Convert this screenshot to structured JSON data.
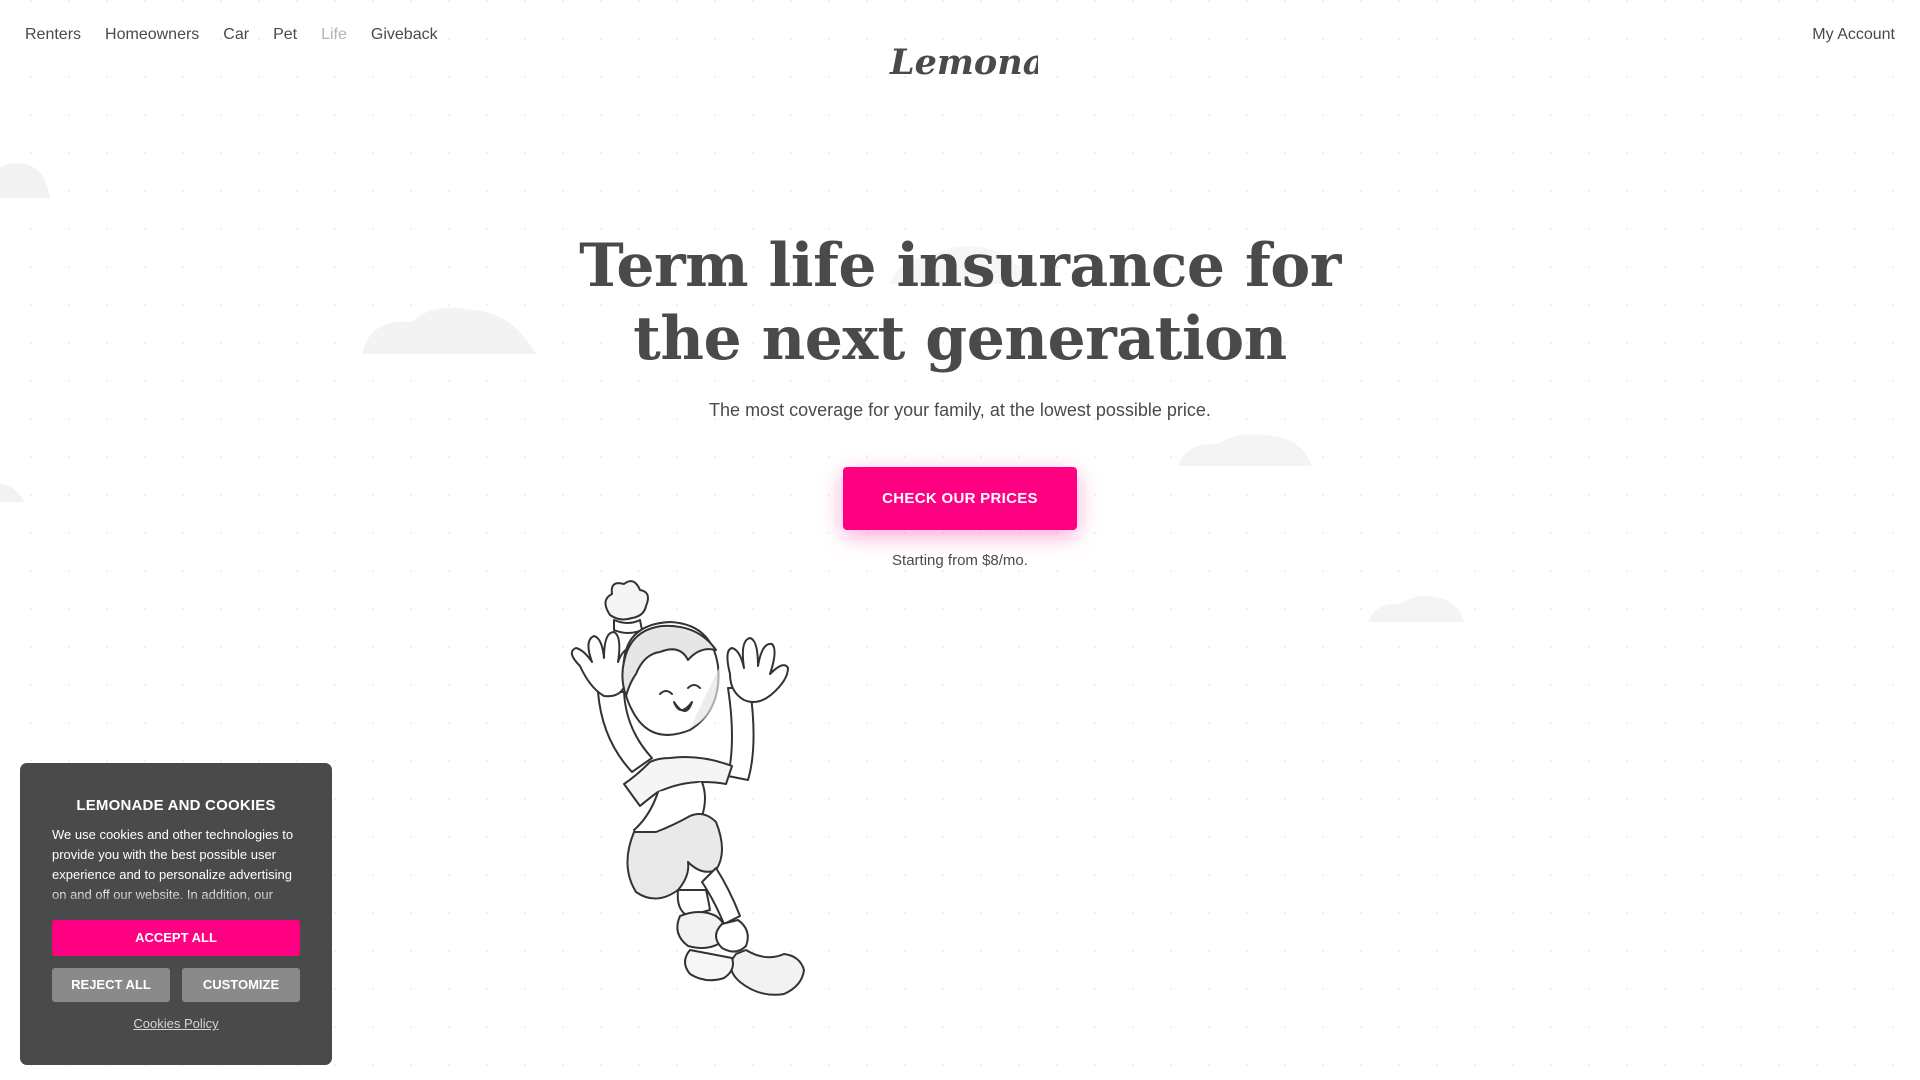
{
  "nav": {
    "items": [
      {
        "label": "Renters",
        "active": false
      },
      {
        "label": "Homeowners",
        "active": false
      },
      {
        "label": "Car",
        "active": false
      },
      {
        "label": "Pet",
        "active": false
      },
      {
        "label": "Life",
        "active": true
      },
      {
        "label": "Giveback",
        "active": false
      }
    ],
    "logo_text": "Lemonade",
    "account_label": "My Account"
  },
  "hero": {
    "title_line1": "Term life insurance for",
    "title_line2": "the next generation",
    "subtitle": "The most coverage for your family, at the lowest possible price.",
    "cta_label": "CHECK OUR PRICES",
    "starting_text": "Starting from $8/mo."
  },
  "cookie_banner": {
    "title": "LEMONADE AND COOKIES",
    "body": "We use cookies and other technologies to provide you with the best possible user experience and to personalize advertising on and off our website. In addition, our partners may use cookies",
    "accept_label": "ACCEPT ALL",
    "reject_label": "REJECT ALL",
    "customize_label": "CUSTOMIZE",
    "policy_link": "Cookies Policy"
  },
  "colors": {
    "brand_pink": "#ff0083",
    "text_dark": "#4a4a4a",
    "nav_active": "#b4b4b4",
    "banner_bg": "#4a4a4a",
    "secondary_button": "#8a8a8a"
  },
  "icons": {
    "logo": "lemonade-wordmark-logo",
    "illustration": "jumping-child-illustration"
  }
}
